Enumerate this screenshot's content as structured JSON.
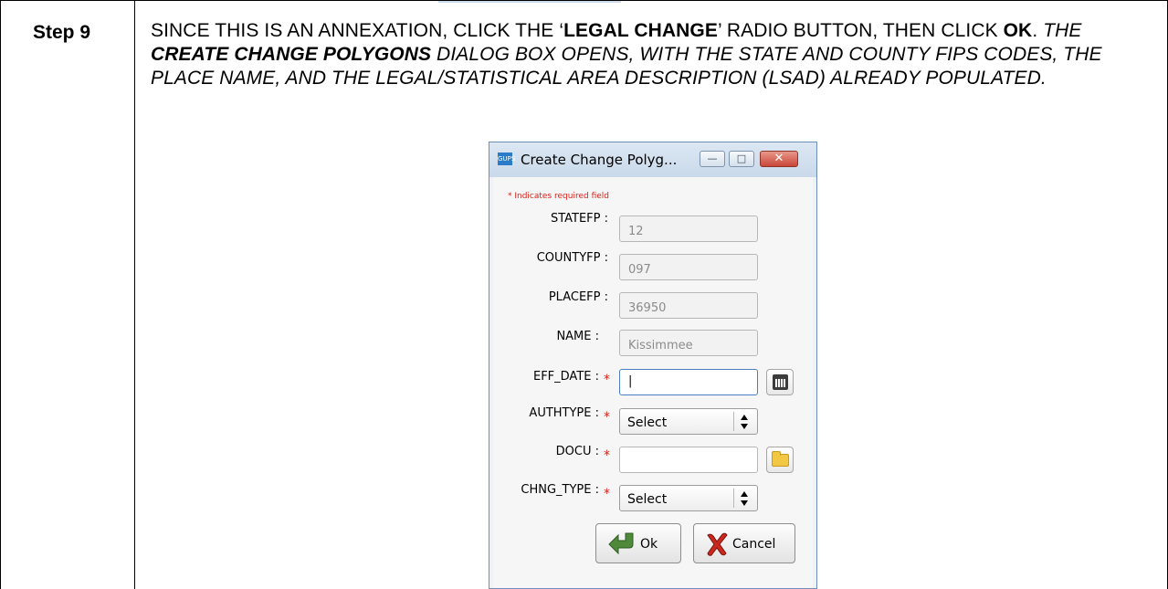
{
  "step": {
    "label": "Step 9"
  },
  "instructions": {
    "part1": "SINCE THIS IS AN ANNEXATION, CLICK THE ‘",
    "bold1": "LEGAL CHANGE",
    "part2": "’ RADIO BUTTON, THEN CLICK ",
    "bold2": "OK",
    "part3": ". ",
    "italic1": "THE ",
    "bold_italic": "CREATE CHANGE POLYGONS",
    "italic2": " DIALOG BOX OPENS, WITH THE STATE AND COUNTY FIPS CODES, THE PLACE NAME, AND THE LEGAL/STATISTICAL AREA DESCRIPTION (LSAD) ALREADY POPULATED."
  },
  "dialog": {
    "app_icon_text": "GUPS",
    "title": "Create Change Polyg...",
    "min_glyph": "—",
    "max_glyph": "□",
    "close_glyph": "✕",
    "required_note": "* Indicates required field",
    "required_star": "*",
    "fields": {
      "statefp": {
        "label": "STATEFP :",
        "value": "12"
      },
      "countyfp": {
        "label": "COUNTYFP :",
        "value": "097"
      },
      "placefp": {
        "label": "PLACEFP :",
        "value": "36950"
      },
      "name": {
        "label": "NAME :",
        "value": "Kissimmee"
      },
      "eff_date": {
        "label": "EFF_DATE :",
        "value": "|"
      },
      "authtype": {
        "label": "AUTHTYPE :",
        "value": "Select"
      },
      "docu": {
        "label": "DOCU :",
        "value": ""
      },
      "chng_type": {
        "label": "CHNG_TYPE :",
        "value": "Select"
      }
    },
    "select_arrows": "▲\n▼",
    "ok_label": "Ok",
    "cancel_label": "Cancel"
  },
  "colors": {
    "required": "#d9231b",
    "ok_arrow": "#4e8a3a",
    "cancel_x": "#c8281e"
  }
}
